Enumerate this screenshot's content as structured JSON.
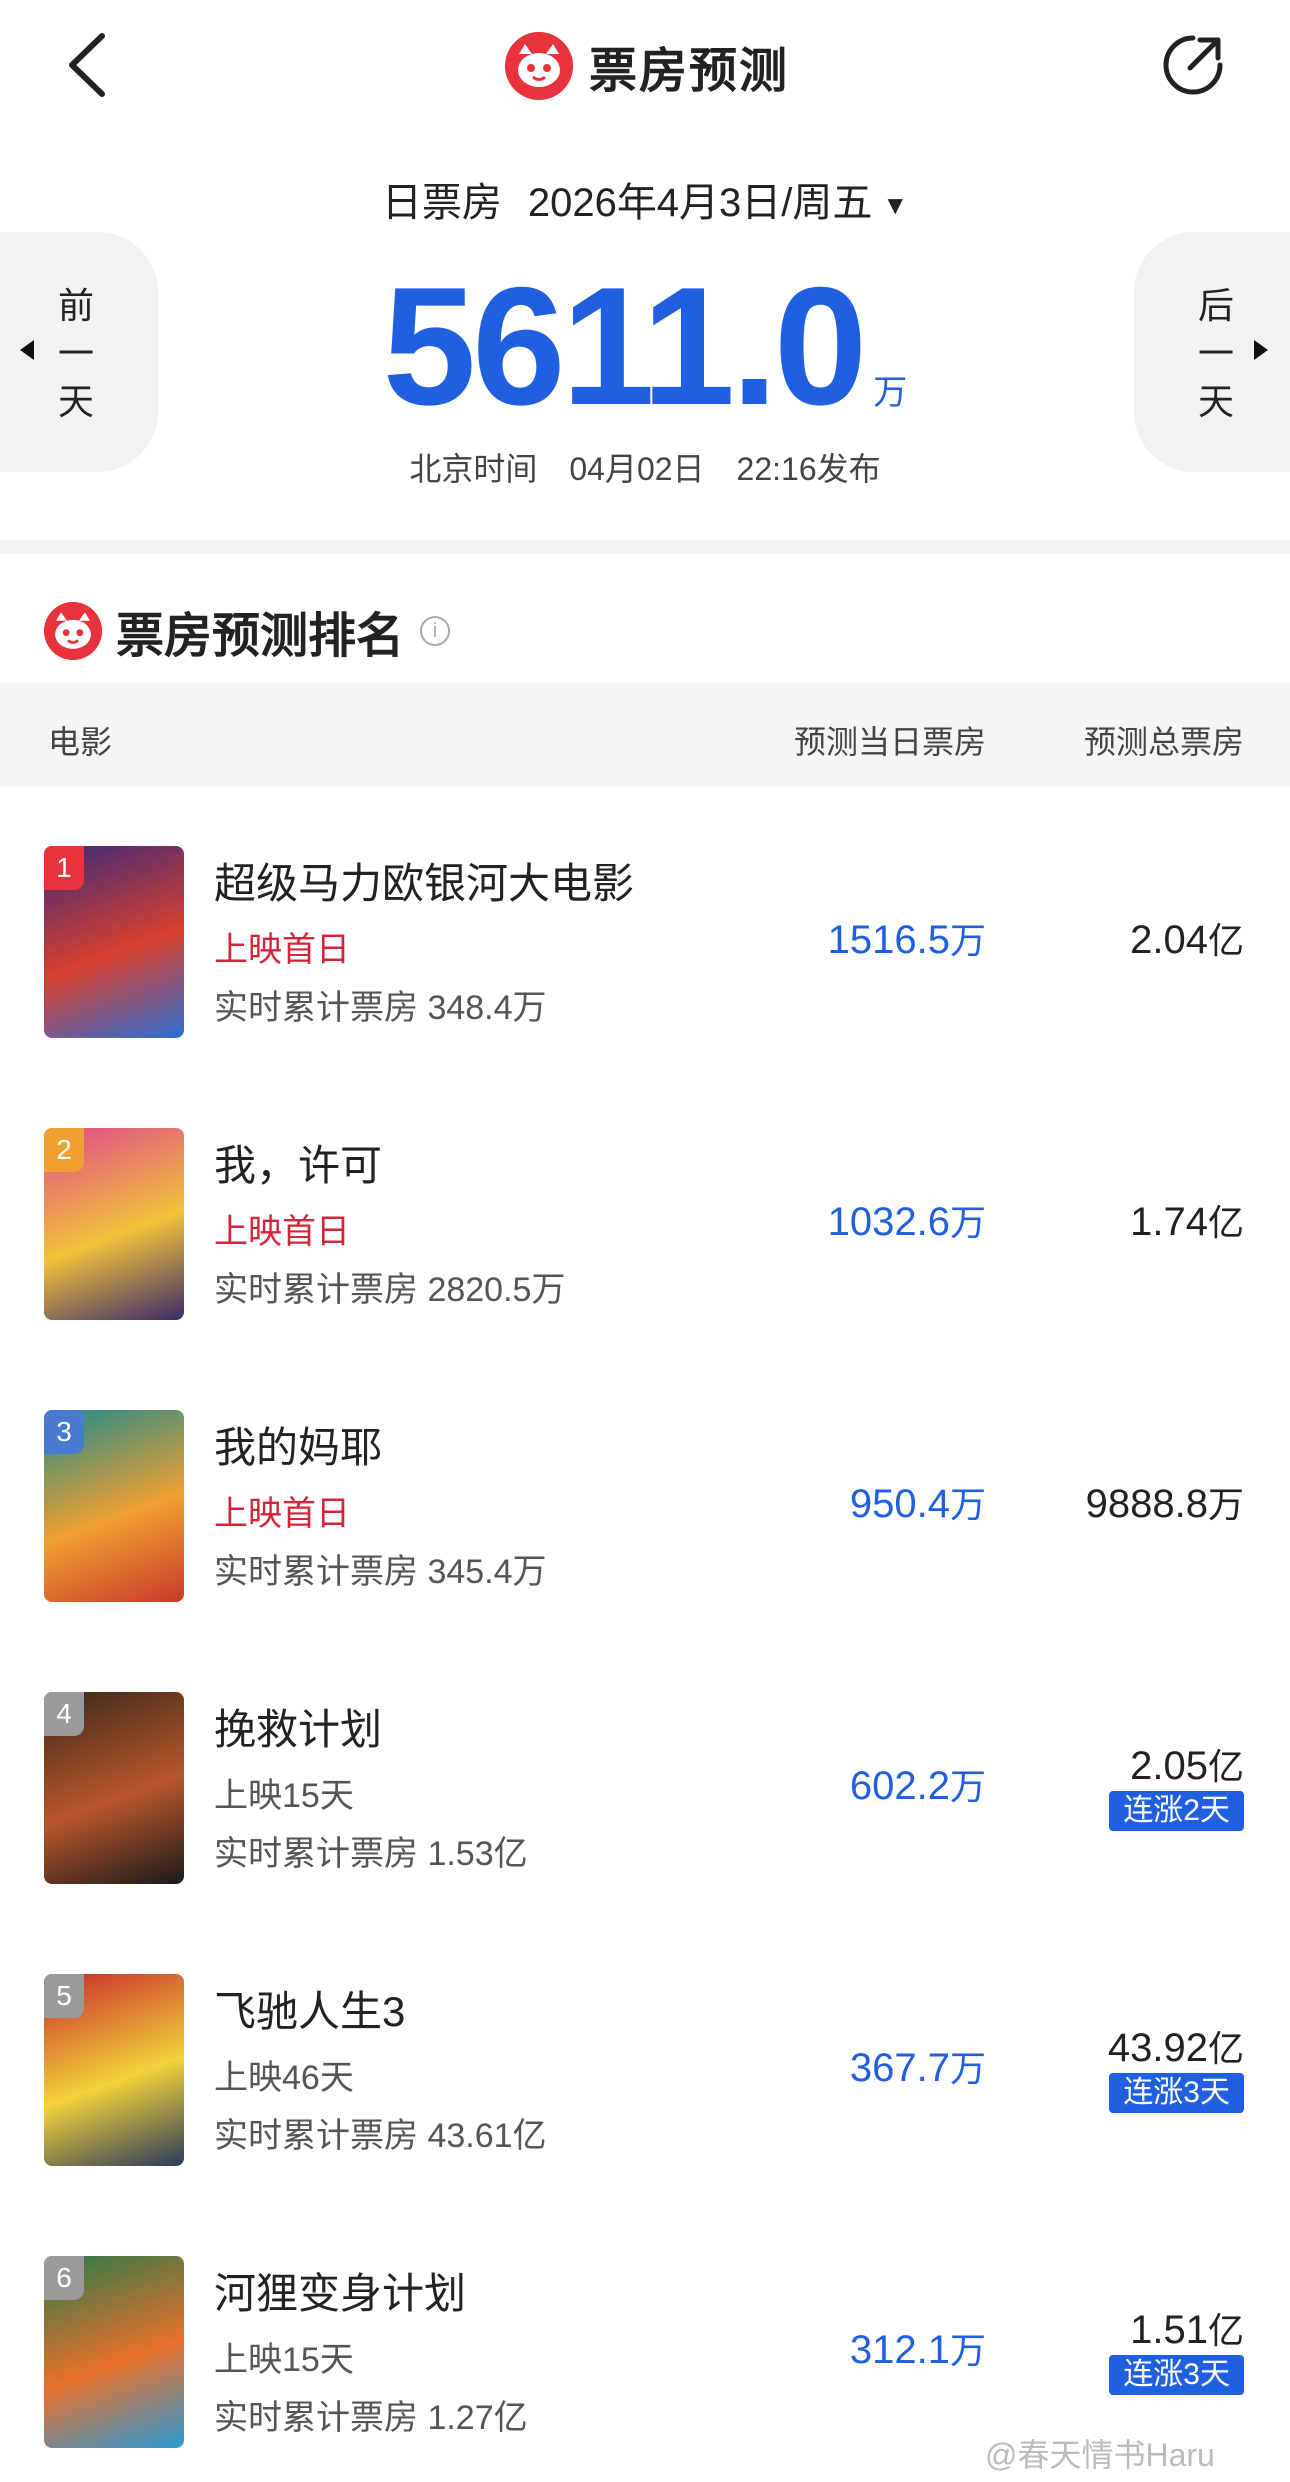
{
  "header": {
    "title": "票房预测"
  },
  "date": {
    "label": "日票房",
    "value": "2026年4月3日/周五"
  },
  "nav": {
    "prev": [
      "前",
      "一",
      "天"
    ],
    "next": [
      "后",
      "一",
      "天"
    ]
  },
  "total": {
    "value": "5611.0",
    "unit": "万"
  },
  "publish": "北京时间　04月02日　22:16发布",
  "ranking": {
    "title": "票房预测排名"
  },
  "columns": {
    "movie": "电影",
    "day": "预测当日票房",
    "total": "预测总票房"
  },
  "movies": [
    {
      "rank": "1",
      "name": "超级马力欧银河大电影",
      "status": "上映首日",
      "cumulative": "实时累计票房 348.4万",
      "day": "1516.5",
      "day_unit": "万",
      "total": "2.04",
      "total_unit": "亿",
      "badge": "",
      "poster_colors": [
        "#3b2a7a",
        "#d8402e",
        "#2c6fd6"
      ]
    },
    {
      "rank": "2",
      "name": "我，许可",
      "status": "上映首日",
      "cumulative": "实时累计票房 2820.5万",
      "day": "1032.6",
      "day_unit": "万",
      "total": "1.74",
      "total_unit": "亿",
      "badge": "",
      "poster_colors": [
        "#e04a8a",
        "#f2c23a",
        "#3a2a6a"
      ]
    },
    {
      "rank": "3",
      "name": "我的妈耶",
      "status": "上映首日",
      "cumulative": "实时累计票房 345.4万",
      "day": "950.4",
      "day_unit": "万",
      "total": "9888.8",
      "total_unit": "万",
      "badge": "",
      "poster_colors": [
        "#1f8a8a",
        "#f0a030",
        "#c83a2a"
      ]
    },
    {
      "rank": "4",
      "name": "挽救计划",
      "status": "上映15天",
      "cumulative": "实时累计票房 1.53亿",
      "day": "602.2",
      "day_unit": "万",
      "total": "2.05",
      "total_unit": "亿",
      "badge": "连涨2天",
      "poster_colors": [
        "#3a2a1a",
        "#b8562a",
        "#1a1a1a"
      ]
    },
    {
      "rank": "5",
      "name": "飞驰人生3",
      "status": "上映46天",
      "cumulative": "实时累计票房 43.61亿",
      "day": "367.7",
      "day_unit": "万",
      "total": "43.92",
      "total_unit": "亿",
      "badge": "连涨3天",
      "poster_colors": [
        "#c82a2a",
        "#f2d23a",
        "#2a3a5a"
      ]
    },
    {
      "rank": "6",
      "name": "河狸变身计划",
      "status": "上映15天",
      "cumulative": "实时累计票房 1.27亿",
      "day": "312.1",
      "day_unit": "万",
      "total": "1.51",
      "total_unit": "亿",
      "badge": "连涨3天",
      "poster_colors": [
        "#2a7a4a",
        "#e8702a",
        "#2a9ad6"
      ]
    }
  ],
  "watermark": "@春天情书Haru"
}
